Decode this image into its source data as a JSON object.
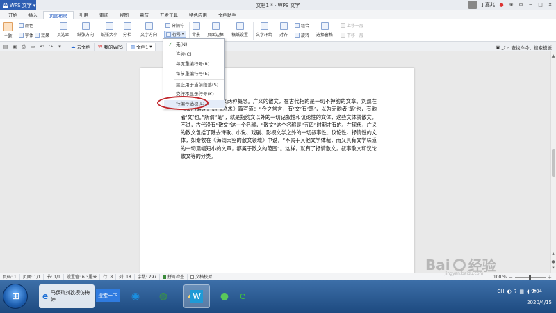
{
  "app": {
    "name": "WPS 文字",
    "logo": "W",
    "document_title": "文档1 * - WPS 文字",
    "user_name": "丁嘉兆"
  },
  "ribbon_tabs": [
    "开始",
    "插入",
    "页面布局",
    "引用",
    "审阅",
    "视图",
    "章节",
    "开发工具",
    "特色应用",
    "文档助手"
  ],
  "active_tab": "页面布局",
  "ribbon": {
    "theme": "主题",
    "color": "颜色",
    "font": "字体",
    "effect": "效果",
    "margin": "页边距",
    "orientation": "纸张方向",
    "size": "纸张大小",
    "columns": "分栏",
    "text_direction": "文字方向",
    "separator": "分隔符",
    "line_number": "行号",
    "background": "背景",
    "page_border": "页面边框",
    "draft": "稿纸设置",
    "text_wrap": "文字环绕",
    "align": "对齐",
    "group": "组合",
    "rotate": "旋转",
    "select_pane": "选择窗格",
    "bring_forward": "上移一层",
    "send_backward": "下移一层"
  },
  "doc_tabs": [
    {
      "label": "云文档",
      "icon": "cloud-icon"
    },
    {
      "label": "我的WPS",
      "icon": "wps-icon"
    },
    {
      "label": "文档1",
      "icon": "doc-icon"
    }
  ],
  "search_label": "查找命令、搜索模板",
  "line_number_menu": {
    "items": [
      {
        "label": "无(N)",
        "checked": true
      },
      {
        "label": "连续(C)"
      },
      {
        "label": "每页重编行号(R)"
      },
      {
        "label": "每节重编行号(E)"
      },
      {
        "label": "禁止用于当前段落(S)"
      },
      {
        "label": "交行不显示行号(K)"
      },
      {
        "label": "行编号选项(L)..."
      }
    ]
  },
  "document": {
    "text": "定义。有广义和狭义两种概念。广义的散文，在古代指的是一切不押韵的文章。刘勰在《文心雕龙》的《总术》篇写道：“今之常言，有‘文’有‘笔’，以为无韵者‘笔’也，有韵者‘文’也。”所谓“笔”，就是指韵文以外的一切记叙性和议论性的文体，这些文体就散文。不过，古代没有“散文”这一个名称，“散文”这个名称是“五四”时期才有的。在现代，广义的散文包括了除去诗歌、小说、戏剧、影视文学之外的一切叙事性、议论性、抒情性的文体，如秦牧在《海阔天空的散文领域》中说，“不属于其他文学体裁，而又具有文学味道的一切篇幅短小的文章，都属于散文的范围”。这样，就有了抒情散文，叙事散文和议论散文等的分类。"
  },
  "status": {
    "page_num": "页码: 1",
    "page": "页面: 1/1",
    "section": "节: 1/1",
    "setting": "设置值: 6.3厘米",
    "row": "行: 8",
    "col": "列: 18",
    "words": "字数: 297",
    "spell": "拼写检查",
    "compare": "文档校对",
    "zoom": "100 %"
  },
  "taskbar": {
    "ie_label": "马伊琍刘孜模仿梅婷",
    "search_btn": "搜索一下",
    "tray_lang": "CH",
    "time": "9:04",
    "date": "2020/4/15"
  },
  "watermark": {
    "brand": "Bai",
    "suffix": "经验",
    "url": "jingyan.baidu.com"
  },
  "colors": {
    "accent": "#2f5fb3",
    "highlight_ring": "#c0252b",
    "taskbar": "#1d4a80"
  }
}
